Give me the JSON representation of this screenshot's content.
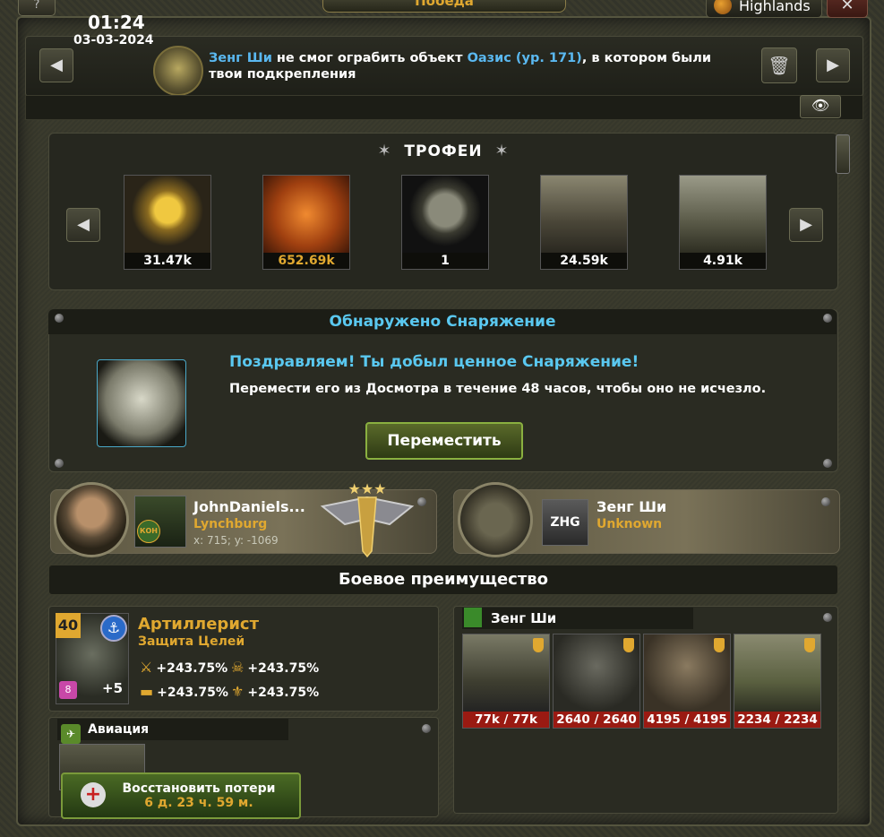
{
  "topbar": {
    "help_label": "?",
    "title": "Победа",
    "server_name": "Highlands",
    "close_label": "✕"
  },
  "message": {
    "time": "01:24",
    "date": "03-03-2024",
    "actor": "Зенг Ши",
    "text_1": " не смог ограбить объект ",
    "target": "Оазис (ур. 171)",
    "text_2": ", в котором были твои подкрепления"
  },
  "trophies": {
    "title": "ТРОФЕИ",
    "items": [
      {
        "icon": "gold-star-wreath-icon",
        "value": "31.47k"
      },
      {
        "icon": "running-soldier-icon",
        "value": "652.69k"
      },
      {
        "icon": "helmet-icon",
        "value": "1"
      },
      {
        "icon": "attack-helicopter-icon",
        "value": "24.59k"
      },
      {
        "icon": "gunship-helicopter-icon",
        "value": "4.91k"
      }
    ]
  },
  "equipment": {
    "title": "Обнаружено Снаряжение",
    "congrats": "Поздравляем! Ты добыл ценное Снаряжение!",
    "info": "Перемести его из Досмотра в течение 48 часов, чтобы оно не исчезло.",
    "move_label": "Переместить"
  },
  "attacker": {
    "name": "JohnDaniels...",
    "city": "Lynchburg",
    "coords": "x: 715; y: -1069",
    "badge_label": "КОН"
  },
  "defender_player": {
    "name": "Зенг Ши",
    "city": "Unknown",
    "badge_label": "ZHG"
  },
  "advantage": {
    "title": "Боевое преимущество"
  },
  "unit": {
    "level": "40",
    "name": "Артиллерист",
    "subtitle": "Защита Целей",
    "rank": "8",
    "plus": "+5",
    "bonuses": [
      "+243.75%",
      "+243.75%",
      "+243.75%",
      "+243.75%"
    ]
  },
  "aviation": {
    "title": "Авиация"
  },
  "restore": {
    "label": "Восстановить потери",
    "time": "6 д. 23 ч. 59 м."
  },
  "defender": {
    "title": "Зенг Ши",
    "units": [
      {
        "icon": "helicopter-icon",
        "count": "77k / 77k"
      },
      {
        "icon": "special-forces-soldier-icon",
        "count": "2640 / 2640"
      },
      {
        "icon": "rifleman-soldier-icon",
        "count": "4195 / 4195"
      },
      {
        "icon": "armored-vehicle-icon",
        "count": "2234 / 2234"
      }
    ]
  },
  "colors": {
    "accent_gold": "#e0a830",
    "accent_blue": "#5ab8f0",
    "loss_red": "#9a1a12",
    "button_green": "#5a6a2a"
  }
}
